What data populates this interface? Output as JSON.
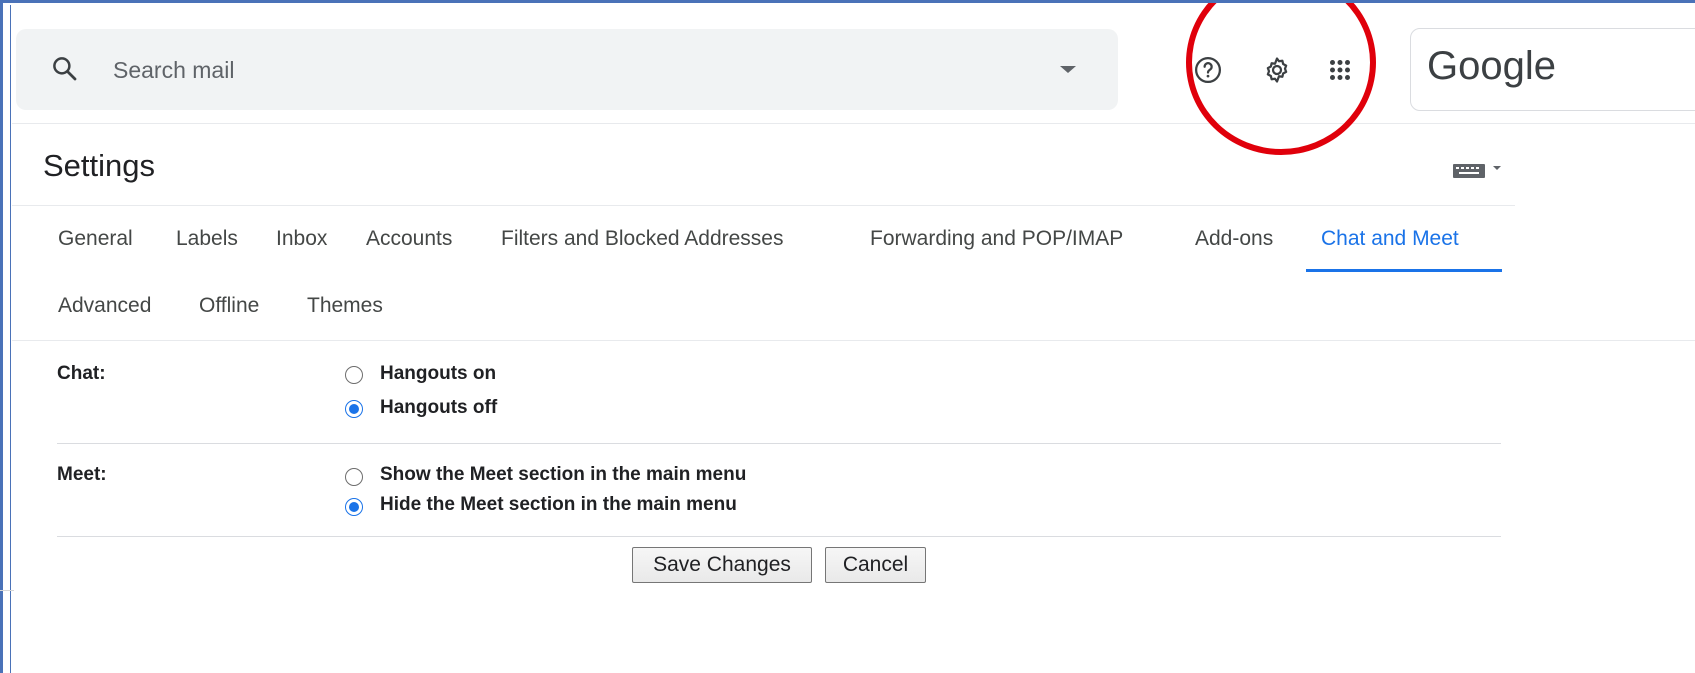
{
  "search": {
    "placeholder": "Search mail"
  },
  "header": {
    "brand": "Google",
    "icons": [
      "help-icon",
      "gear-icon",
      "apps-grid-icon"
    ]
  },
  "settings": {
    "title": "Settings",
    "tabs": [
      {
        "label": "General"
      },
      {
        "label": "Labels"
      },
      {
        "label": "Inbox"
      },
      {
        "label": "Accounts"
      },
      {
        "label": "Filters and Blocked Addresses"
      },
      {
        "label": "Forwarding and POP/IMAP"
      },
      {
        "label": "Add-ons"
      },
      {
        "label": "Chat and Meet",
        "active": true
      },
      {
        "label": "Advanced"
      },
      {
        "label": "Offline"
      },
      {
        "label": "Themes"
      }
    ],
    "sections": [
      {
        "label": "Chat:",
        "options": [
          {
            "label": "Hangouts on",
            "checked": false
          },
          {
            "label": "Hangouts off",
            "checked": true
          }
        ]
      },
      {
        "label": "Meet:",
        "options": [
          {
            "label": "Show the Meet section in the main menu",
            "checked": false
          },
          {
            "label": "Hide the Meet section in the main menu",
            "checked": true
          }
        ]
      }
    ],
    "buttons": {
      "save": "Save Changes",
      "cancel": "Cancel"
    }
  },
  "colors": {
    "accent": "#1a73e8",
    "annotation_circle": "#e0000b"
  }
}
